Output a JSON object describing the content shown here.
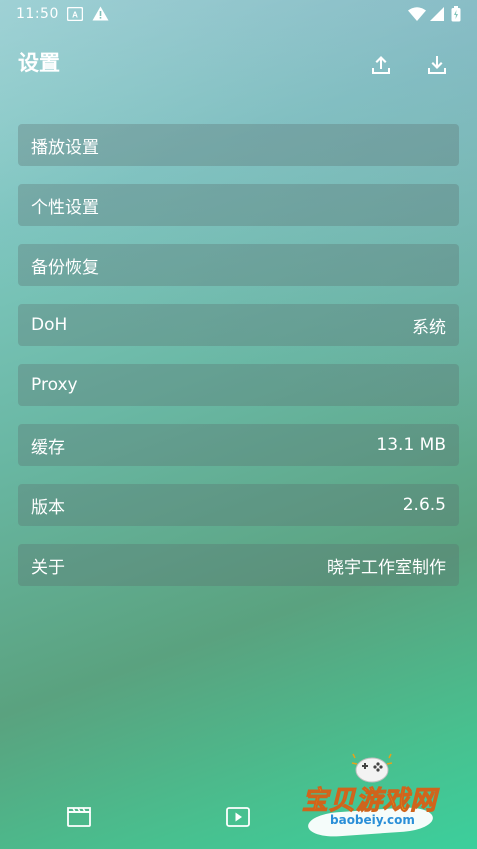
{
  "status_bar": {
    "time": "11:50"
  },
  "header": {
    "title": "设置",
    "upload_icon": "upload-icon",
    "download_icon": "download-icon"
  },
  "settings": {
    "items": [
      {
        "label": "播放设置",
        "value": ""
      },
      {
        "label": "个性设置",
        "value": ""
      },
      {
        "label": "备份恢复",
        "value": ""
      },
      {
        "label": "DoH",
        "value": "系统"
      },
      {
        "label": "Proxy",
        "value": ""
      },
      {
        "label": "缓存",
        "value": "13.1 MB"
      },
      {
        "label": "版本",
        "value": "2.6.5"
      },
      {
        "label": "关于",
        "value": "晓宇工作室制作"
      }
    ]
  },
  "bottom_nav": {
    "items": [
      "film-icon",
      "play-icon"
    ]
  },
  "watermark": {
    "title": "宝贝游戏网",
    "url": "baobeiy.com"
  },
  "colors": {
    "text": "#ffffff",
    "item_bg": "rgba(90,110,110,0.32)",
    "watermark_title": "#f6c21a",
    "watermark_url": "#2a8fd8"
  }
}
